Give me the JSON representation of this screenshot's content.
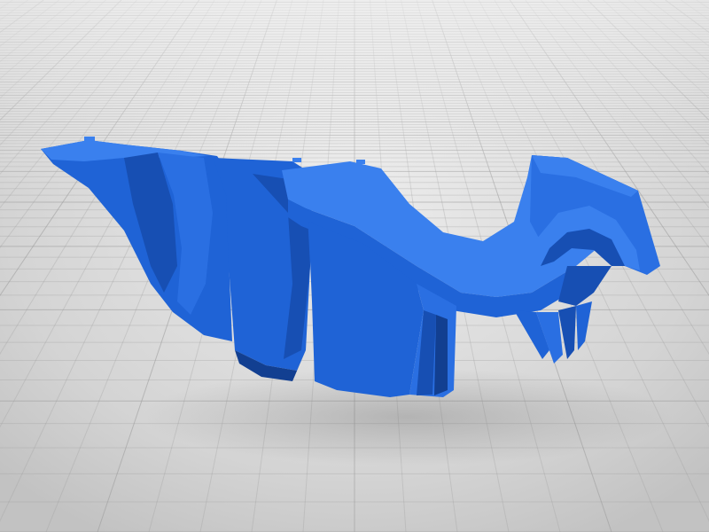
{
  "scene": {
    "background_color": "#d4d4d4",
    "grid_color": "#9a9a9a",
    "model_colors": {
      "base": "#1f63d6",
      "light": "#3a80ee",
      "mid": "#2a6fe2",
      "dark": "#174fb3",
      "deep": "#123f91"
    }
  }
}
